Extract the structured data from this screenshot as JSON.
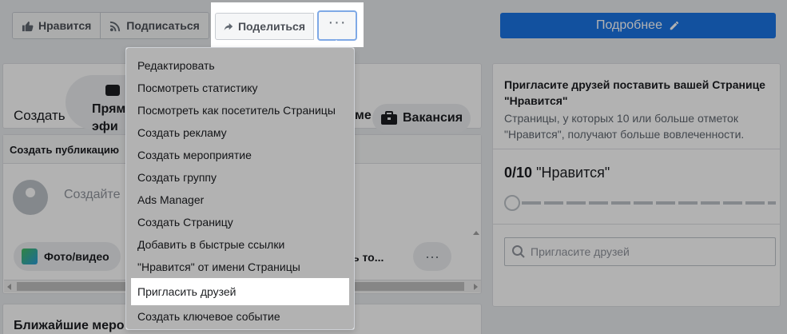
{
  "toolbar": {
    "like_label": "Нравится",
    "follow_label": "Подписаться",
    "share_label": "Поделиться",
    "more_label": "···",
    "details_label": "Подробнее"
  },
  "create": {
    "create_label": "Создать",
    "live_label_line1": "Прям",
    "live_label_line2": "эфи",
    "partial_label": "ме",
    "jobs_label": "Вакансия"
  },
  "post": {
    "header": "Создать публикацию",
    "placeholder": "Создайте",
    "photo_label": "Фото/видео",
    "partial_label": "ь то...",
    "dots_label": "···"
  },
  "nearby": {
    "title": "Ближайшие меро"
  },
  "invite": {
    "title": "Пригласите друзей поставить вашей Странице \"Нравится\"",
    "description": "Страницы, у которых 10 или больше отметок \"Нравится\", получают больше вовлеченности.",
    "count": "0/10",
    "count_suffix": "\"Нравится\"",
    "search_placeholder": "Пригласите друзей",
    "progress_fraction": 0
  },
  "menu": {
    "items": [
      "Редактировать",
      "Посмотреть статистику",
      "Посмотреть как посетитель Страницы",
      "Создать рекламу",
      "Создать мероприятие",
      "Создать группу",
      "Ads Manager",
      "Создать Страницу",
      "Добавить в быстрые ссылки",
      "\"Нравится\" от имени Страницы",
      "Пригласить друзей",
      "Создать ключевое событие"
    ],
    "highlighted_index": 10
  },
  "colors": {
    "primary_button": "#1b74e4",
    "focus_ring": "#7fa9e6"
  }
}
